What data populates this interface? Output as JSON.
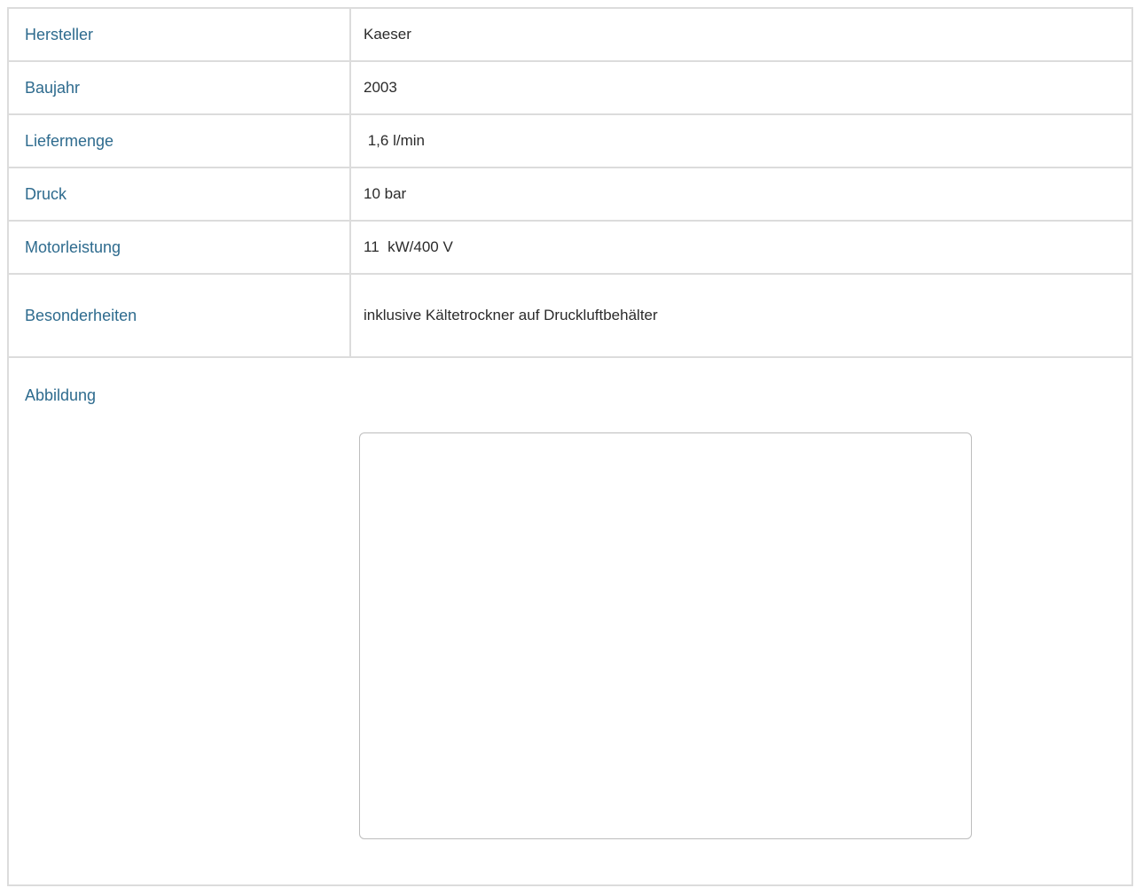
{
  "specs": [
    {
      "label": "Hersteller",
      "value": "Kaeser"
    },
    {
      "label": "Baujahr",
      "value": "2003"
    },
    {
      "label": "Liefermenge",
      "value": " 1,6 l/min"
    },
    {
      "label": "Druck",
      "value": "10 bar"
    },
    {
      "label": "Motorleistung",
      "value": "11  kW/400 V"
    },
    {
      "label": "Besonderheiten",
      "value": "inklusive Kältetrockner auf Druckluftbehälter"
    }
  ],
  "image_section": {
    "label": "Abbildung"
  },
  "colors": {
    "label_text": "#2e6b8e",
    "value_text": "#2b2b2b",
    "border": "#dcdcdc"
  }
}
